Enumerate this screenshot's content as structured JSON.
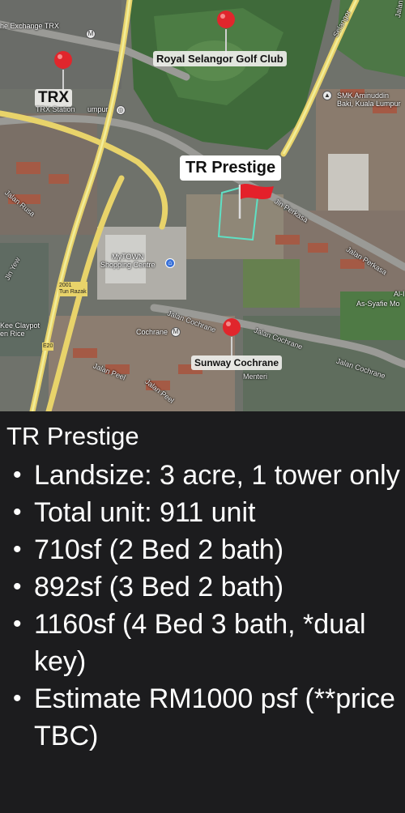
{
  "map": {
    "labels": {
      "exchange_trx": "he Exchange TRX",
      "trx": "TRX",
      "trx_station": "TRX Station",
      "trx_station_suffix": "umpur",
      "golf_club": "Royal Selangor Golf Club",
      "tr_prestige": "TR Prestige",
      "sunway_cochrane": "Sunway Cochrane",
      "mytown": "MyTOWN\nShopping Centre",
      "cochrane_station": "Cochrane",
      "smk": "SMK Aminuddin\nBaki, Kuala Lumpur",
      "as_syafie": "As-Syafie Mo",
      "al_i": "Al-I",
      "kee_claypot": "Kee Claypot\nen Rice",
      "tun_razak": "2001\nTun Razak",
      "e20": "E20"
    },
    "streets": [
      "Selangor",
      "Jalan Rusa",
      "Jln Yew",
      "Jln Perkasa",
      "Jalan Perkasa",
      "Jalan Cochrane",
      "Jalan Cochrane",
      "Jalan Cochrane",
      "Jalan Peel",
      "Jalan Peel",
      "Menteri",
      "Jalan"
    ],
    "colors": {
      "pin_red": "#e0262c",
      "flag_red": "#e4202a",
      "highway": "#e8d36a",
      "plot_outline": "#5fe0c4"
    },
    "icons": [
      "map-pin-icon",
      "flag-icon",
      "metro-station-icon",
      "shopping-icon",
      "school-icon"
    ]
  },
  "info": {
    "title": "TR Prestige",
    "items": [
      "Landsize: 3 acre, 1 tower only",
      "Total unit: 911 unit",
      "710sf (2 Bed 2 bath)",
      "892sf (3 Bed 2 bath)",
      "1160sf (4 Bed 3 bath, *dual key)",
      "Estimate RM1000 psf (**price TBC)"
    ]
  }
}
